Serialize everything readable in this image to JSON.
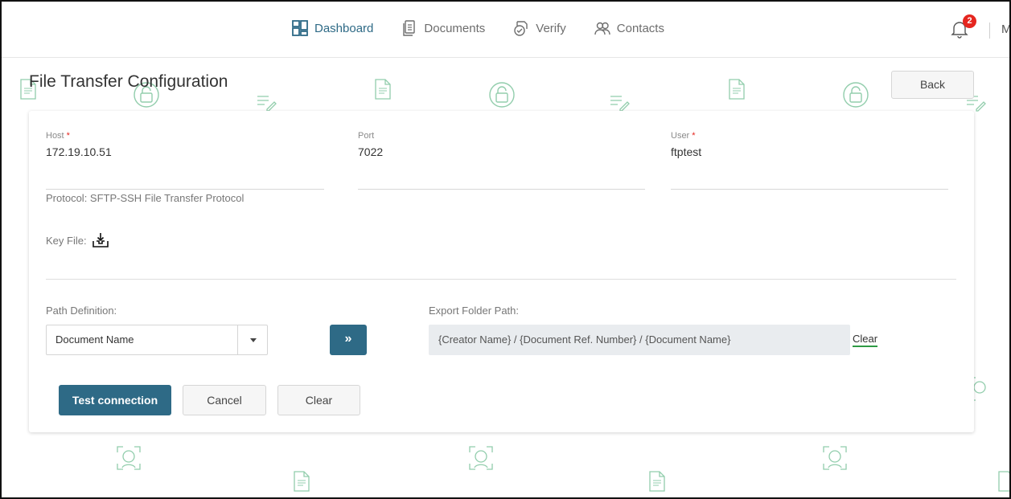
{
  "nav": {
    "items": [
      {
        "label": "Dashboard",
        "icon": "dashboard-icon",
        "active": true
      },
      {
        "label": "Documents",
        "icon": "documents-icon",
        "active": false
      },
      {
        "label": "Verify",
        "icon": "verify-icon",
        "active": false
      },
      {
        "label": "Contacts",
        "icon": "contacts-icon",
        "active": false
      }
    ],
    "notification_count": "2",
    "user_initial": "M"
  },
  "page": {
    "title": "File Transfer Configuration",
    "back_label": "Back"
  },
  "form": {
    "host": {
      "label": "Host",
      "value": "172.19.10.51",
      "required": true
    },
    "port": {
      "label": "Port",
      "value": "7022",
      "required": false
    },
    "user": {
      "label": "User",
      "value": "ftptest",
      "required": true
    },
    "protocol_text": "Protocol: SFTP-SSH File Transfer Protocol",
    "key_file_label": "Key File:",
    "path_definition": {
      "label": "Path Definition:",
      "selected": "Document Name"
    },
    "add_button_label": "»",
    "export_folder": {
      "label": "Export Folder Path:",
      "value": "{Creator Name} / {Document Ref. Number} / {Document Name}",
      "clear_label": "Clear"
    }
  },
  "actions": {
    "test_connection": "Test connection",
    "cancel": "Cancel",
    "clear": "Clear"
  },
  "colors": {
    "primary": "#2e6a86",
    "badge": "#e5261f",
    "watermark": "#3aa66a",
    "required": "#e5261f"
  }
}
